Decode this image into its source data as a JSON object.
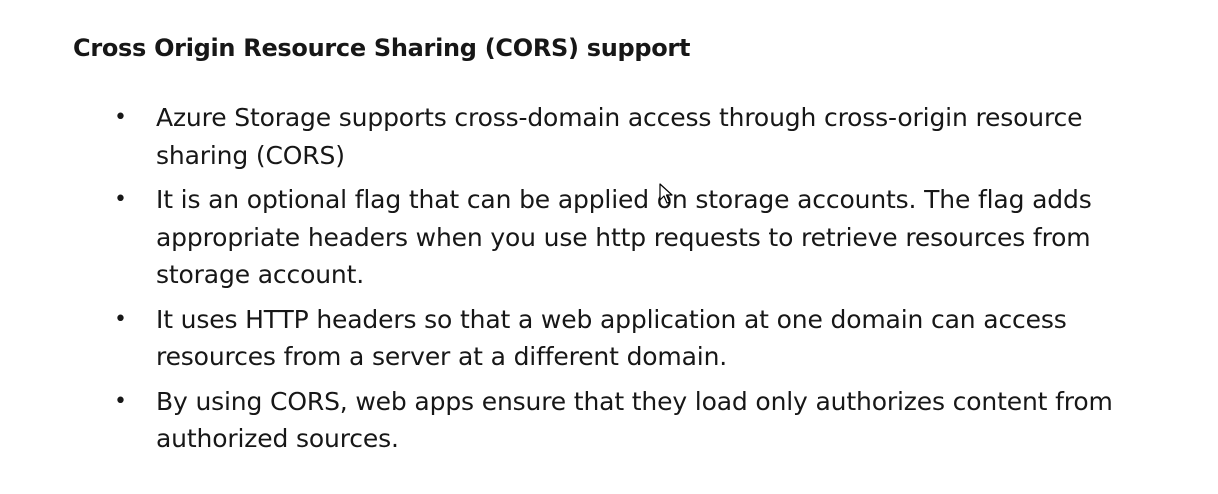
{
  "heading": "Cross Origin Resource Sharing (CORS) support",
  "bullet_glyph": "•",
  "items": [
    {
      "text": "Azure Storage supports cross-domain access through cross-origin resource sharing (CORS)"
    },
    {
      "text": "It is an optional flag that can be applied on storage accounts. The flag adds appropriate headers when you use http requests to retrieve resources from storage account."
    },
    {
      "text": "It uses HTTP headers so that a web application at one domain can access resources from a server at a different domain."
    },
    {
      "text": "By using CORS, web apps ensure that they load only authorizes content from authorized sources."
    }
  ],
  "cursor_icon": "mouse-pointer-icon"
}
